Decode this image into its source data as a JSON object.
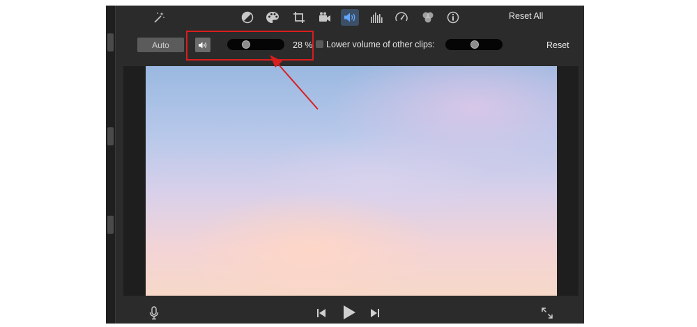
{
  "toolbar": {
    "icons": [
      "magic-wand-icon",
      "color-balance-icon",
      "palette-icon",
      "crop-icon",
      "camera-icon",
      "volume-icon",
      "equalizer-icon",
      "speed-icon",
      "overlay-icon",
      "info-icon"
    ],
    "active_icon": "volume-icon",
    "reset_all_label": "Reset All"
  },
  "audio_controls": {
    "auto_label": "Auto",
    "volume_percent": 28,
    "volume_text": "28 %",
    "lower_volume_label": "Lower volume of other clips:",
    "lower_volume_checked": false,
    "lower_volume_percent": 50,
    "reset_label": "Reset"
  },
  "playback": {
    "icons": [
      "microphone-icon",
      "skip-back-icon",
      "play-icon",
      "skip-forward-icon",
      "fullscreen-icon"
    ]
  },
  "colors": {
    "active_highlight": "#63a6ff",
    "annotation_red": "#d81e1e"
  }
}
